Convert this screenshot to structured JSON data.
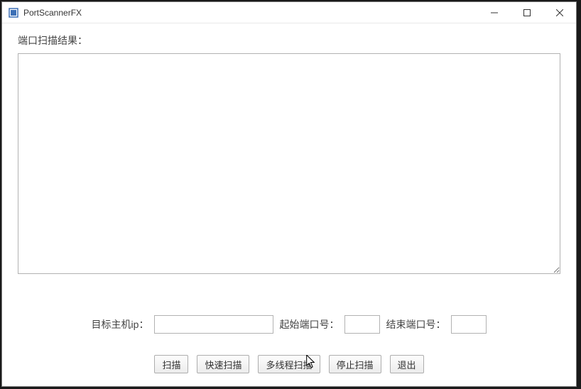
{
  "window": {
    "title": "PortScannerFX"
  },
  "labels": {
    "result": "端口扫描结果：",
    "target_ip": "目标主机ip：",
    "start_port": "起始端口号：",
    "end_port": "结束端口号："
  },
  "inputs": {
    "target_ip": "",
    "start_port": "",
    "end_port": ""
  },
  "result_text": "",
  "buttons": {
    "scan": "扫描",
    "fast_scan": "快速扫描",
    "multi_thread_scan": "多线程扫描",
    "stop_scan": "停止扫描",
    "exit": "退出"
  }
}
